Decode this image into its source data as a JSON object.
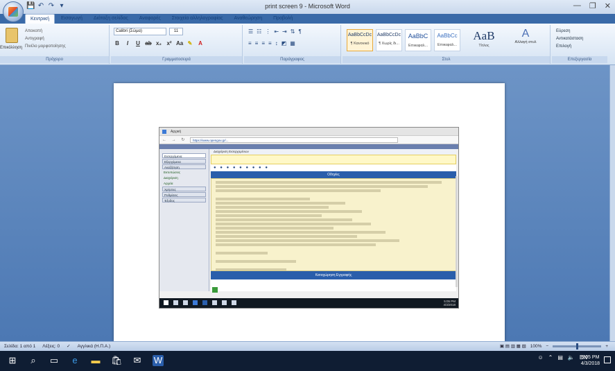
{
  "window": {
    "title": "print screen 9 - Microsoft Word",
    "controls": [
      "—",
      "❐",
      "✕"
    ]
  },
  "qat": [
    "💾",
    "↶",
    "↷",
    "▾"
  ],
  "tabs": [
    "Κεντρική",
    "Εισαγωγή",
    "Διάταξη σελίδας",
    "Αναφορές",
    "Στοιχεία αλληλογραφίας",
    "Αναθεώρηση",
    "Προβολή"
  ],
  "ribbon": {
    "clipboard": {
      "paste_label": "Επικόλληση",
      "cut": "Αποκοπή",
      "copy": "Αντιγραφή",
      "format_painter": "Πινέλο μορφοποίησης",
      "group_name": "Πρόχειρο"
    },
    "font": {
      "font_name": "Calibri (Σώμα)",
      "font_size": "11",
      "group_name": "Γραμματοσειρά"
    },
    "paragraph": {
      "group_name": "Παράγραφος"
    },
    "styles": {
      "items": [
        {
          "sample": "AaBbCcDc",
          "name": "¶ Κανονικό"
        },
        {
          "sample": "AaBbCcDc",
          "name": "¶ Χωρίς δι..."
        },
        {
          "sample": "AaBbC",
          "name": "Επικεφαλ..."
        },
        {
          "sample": "AaBbCc",
          "name": "Επικεφαλ..."
        }
      ],
      "title_sample": "AaB",
      "title_name": "Τίτλος",
      "change_label": "Αλλαγή στυλ",
      "group_name": "Στυλ"
    },
    "editing": {
      "find": "Εύρεση",
      "replace": "Αντικατάσταση",
      "select": "Επιλογή",
      "group_name": "Επεξεργασία"
    }
  },
  "embedded": {
    "browser_tab": "Αρχική",
    "url": "https://www.opengov.gr/...",
    "nav": "← → ↻ ⌂",
    "title": "Διαχείριση Εισερχομένων",
    "header_bar": "Οδηγίες",
    "footer_bar": "Καταχώρηση Εγγραφής",
    "icons": "● ● ● ● ● ● ● ● ●",
    "left_menu": [
      "Εισερχόμενα",
      "Εξερχόμενα",
      "Αναζήτηση",
      "Εκτυπώσεις",
      "Διαχείριση",
      "Αρχεία",
      "Χρήστες",
      "Ρυθμίσεις",
      "Έξοδος"
    ],
    "clock_time": "5:05 PM",
    "clock_date": "4/3/2018"
  },
  "status": {
    "page": "Σελίδα: 1 από 1",
    "words": "Λέξεις: 0",
    "language": "Αγγλικά (Η.Π.Α.)",
    "zoom": "100%"
  },
  "taskbar": {
    "time": "5:05 PM",
    "date": "4/3/2018",
    "lang": "EN"
  }
}
